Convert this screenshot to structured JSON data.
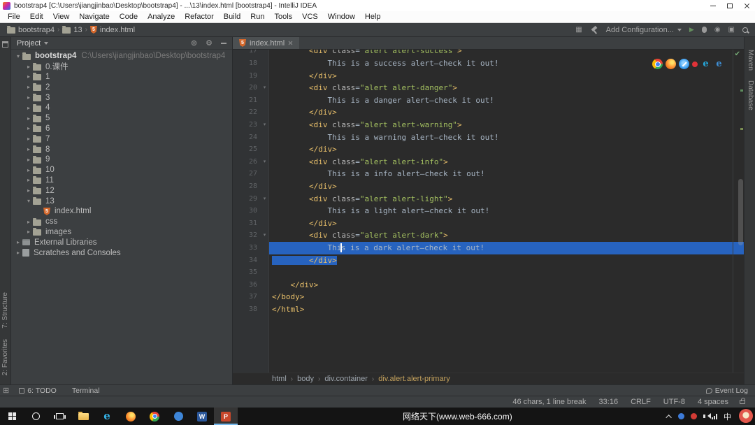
{
  "window": {
    "title": "bootstrap4 [C:\\Users\\jiangjinbao\\Desktop\\bootstrap4] - ...\\13\\index.html [bootstrap4] - IntelliJ IDEA"
  },
  "menu": {
    "items": [
      "File",
      "Edit",
      "View",
      "Navigate",
      "Code",
      "Analyze",
      "Refactor",
      "Build",
      "Run",
      "Tools",
      "VCS",
      "Window",
      "Help"
    ]
  },
  "navbar": {
    "crumbs": [
      {
        "label": "bootstrap4",
        "icon": "folder"
      },
      {
        "label": "13",
        "icon": "folder"
      },
      {
        "label": "index.html",
        "icon": "html"
      }
    ],
    "add_configuration": "Add Configuration..."
  },
  "project_panel": {
    "title": "Project",
    "tree": [
      {
        "label": "bootstrap4",
        "suffix": "C:\\Users\\jiangjinbao\\Desktop\\bootstrap4",
        "icon": "folder",
        "depth": 0,
        "chevron": "down",
        "bold": true
      },
      {
        "label": "0.课件",
        "icon": "folder",
        "depth": 1,
        "chevron": "right"
      },
      {
        "label": "1",
        "icon": "folder",
        "depth": 1,
        "chevron": "right"
      },
      {
        "label": "2",
        "icon": "folder",
        "depth": 1,
        "chevron": "right"
      },
      {
        "label": "3",
        "icon": "folder",
        "depth": 1,
        "chevron": "right"
      },
      {
        "label": "4",
        "icon": "folder",
        "depth": 1,
        "chevron": "right"
      },
      {
        "label": "5",
        "icon": "folder",
        "depth": 1,
        "chevron": "right"
      },
      {
        "label": "6",
        "icon": "folder",
        "depth": 1,
        "chevron": "right"
      },
      {
        "label": "7",
        "icon": "folder",
        "depth": 1,
        "chevron": "right"
      },
      {
        "label": "8",
        "icon": "folder",
        "depth": 1,
        "chevron": "right"
      },
      {
        "label": "9",
        "icon": "folder",
        "depth": 1,
        "chevron": "right"
      },
      {
        "label": "10",
        "icon": "folder",
        "depth": 1,
        "chevron": "right"
      },
      {
        "label": "11",
        "icon": "folder",
        "depth": 1,
        "chevron": "right"
      },
      {
        "label": "12",
        "icon": "folder",
        "depth": 1,
        "chevron": "right"
      },
      {
        "label": "13",
        "icon": "folder",
        "depth": 1,
        "chevron": "down"
      },
      {
        "label": "index.html",
        "icon": "html",
        "depth": 2,
        "chevron": "none"
      },
      {
        "label": "css",
        "icon": "folder",
        "depth": 1,
        "chevron": "right"
      },
      {
        "label": "images",
        "icon": "folder",
        "depth": 1,
        "chevron": "right"
      },
      {
        "label": "External Libraries",
        "icon": "lib",
        "depth": 0,
        "chevron": "right"
      },
      {
        "label": "Scratches and Consoles",
        "icon": "scratch",
        "depth": 0,
        "chevron": "right"
      }
    ]
  },
  "tabs": [
    {
      "label": "index.html",
      "icon": "html"
    }
  ],
  "editor": {
    "lines": [
      {
        "n": 17,
        "partial": true,
        "tokens": [
          {
            "c": "ws",
            "t": "        "
          },
          {
            "c": "tag",
            "t": "<div "
          },
          {
            "c": "attr",
            "t": "class"
          },
          {
            "c": "eq",
            "t": "="
          },
          {
            "c": "str",
            "t": "\"alert alert-success\""
          },
          {
            "c": "tag",
            "t": ">"
          }
        ]
      },
      {
        "n": 18,
        "tokens": [
          {
            "c": "ws",
            "t": "            "
          },
          {
            "c": "text",
            "t": "This is a success alert—check it out!"
          }
        ]
      },
      {
        "n": 19,
        "tokens": [
          {
            "c": "ws",
            "t": "        "
          },
          {
            "c": "tag",
            "t": "</div>"
          }
        ]
      },
      {
        "n": 20,
        "fold": true,
        "tokens": [
          {
            "c": "ws",
            "t": "        "
          },
          {
            "c": "tag",
            "t": "<div "
          },
          {
            "c": "attr",
            "t": "class"
          },
          {
            "c": "eq",
            "t": "="
          },
          {
            "c": "str",
            "t": "\"alert alert-danger\""
          },
          {
            "c": "tag",
            "t": ">"
          }
        ]
      },
      {
        "n": 21,
        "tokens": [
          {
            "c": "ws",
            "t": "            "
          },
          {
            "c": "text",
            "t": "This is a danger alert—check it out!"
          }
        ]
      },
      {
        "n": 22,
        "tokens": [
          {
            "c": "ws",
            "t": "        "
          },
          {
            "c": "tag",
            "t": "</div>"
          }
        ]
      },
      {
        "n": 23,
        "fold": true,
        "tokens": [
          {
            "c": "ws",
            "t": "        "
          },
          {
            "c": "tag",
            "t": "<div "
          },
          {
            "c": "attr",
            "t": "class"
          },
          {
            "c": "eq",
            "t": "="
          },
          {
            "c": "str",
            "t": "\"alert alert-warning\""
          },
          {
            "c": "tag",
            "t": ">"
          }
        ]
      },
      {
        "n": 24,
        "tokens": [
          {
            "c": "ws",
            "t": "            "
          },
          {
            "c": "text",
            "t": "This is a warning alert—check it out!"
          }
        ]
      },
      {
        "n": 25,
        "tokens": [
          {
            "c": "ws",
            "t": "        "
          },
          {
            "c": "tag",
            "t": "</div>"
          }
        ]
      },
      {
        "n": 26,
        "fold": true,
        "tokens": [
          {
            "c": "ws",
            "t": "        "
          },
          {
            "c": "tag",
            "t": "<div "
          },
          {
            "c": "attr",
            "t": "class"
          },
          {
            "c": "eq",
            "t": "="
          },
          {
            "c": "str",
            "t": "\"alert alert-info\""
          },
          {
            "c": "tag",
            "t": ">"
          }
        ]
      },
      {
        "n": 27,
        "tokens": [
          {
            "c": "ws",
            "t": "            "
          },
          {
            "c": "text",
            "t": "This is a info alert—check it out!"
          }
        ]
      },
      {
        "n": 28,
        "tokens": [
          {
            "c": "ws",
            "t": "        "
          },
          {
            "c": "tag",
            "t": "</div>"
          }
        ]
      },
      {
        "n": 29,
        "fold": true,
        "tokens": [
          {
            "c": "ws",
            "t": "        "
          },
          {
            "c": "tag",
            "t": "<div "
          },
          {
            "c": "attr",
            "t": "class"
          },
          {
            "c": "eq",
            "t": "="
          },
          {
            "c": "str",
            "t": "\"alert alert-light\""
          },
          {
            "c": "tag",
            "t": ">"
          }
        ]
      },
      {
        "n": 30,
        "tokens": [
          {
            "c": "ws",
            "t": "            "
          },
          {
            "c": "text",
            "t": "This is a light alert—check it out!"
          }
        ]
      },
      {
        "n": 31,
        "tokens": [
          {
            "c": "ws",
            "t": "        "
          },
          {
            "c": "tag",
            "t": "</div>"
          }
        ]
      },
      {
        "n": 32,
        "fold": true,
        "tokens": [
          {
            "c": "ws",
            "t": "        "
          },
          {
            "c": "tag",
            "t": "<div "
          },
          {
            "c": "attr",
            "t": "class"
          },
          {
            "c": "eq",
            "t": "="
          },
          {
            "c": "str",
            "t": "\"alert alert-dark\""
          },
          {
            "c": "tag",
            "t": ">"
          }
        ]
      },
      {
        "n": 33,
        "sel": "full",
        "tokens": [
          {
            "c": "ws",
            "t": "            "
          },
          {
            "c": "text",
            "t": "Thi"
          },
          {
            "c": "caret",
            "t": ""
          },
          {
            "c": "text",
            "t": "s is a dark alert—check it out!"
          }
        ]
      },
      {
        "n": 34,
        "sel": "text",
        "tokens": [
          {
            "c": "ws",
            "t": "        "
          },
          {
            "c": "tag",
            "t": "</div>"
          }
        ]
      },
      {
        "n": 35,
        "tokens": []
      },
      {
        "n": 36,
        "tokens": [
          {
            "c": "ws",
            "t": "    "
          },
          {
            "c": "tag",
            "t": "</div>"
          }
        ]
      },
      {
        "n": 37,
        "tokens": [
          {
            "c": "tag",
            "t": "</body>"
          }
        ]
      },
      {
        "n": 38,
        "tokens": [
          {
            "c": "tag",
            "t": "</html>"
          }
        ]
      }
    ],
    "breadcrumbs": [
      {
        "label": "html"
      },
      {
        "label": "body"
      },
      {
        "label": "div.container"
      },
      {
        "label": "div.alert.alert-primary",
        "current": true
      }
    ]
  },
  "browser_icons": [
    "chrome",
    "firefox",
    "safari",
    "opera",
    "edge",
    "ie"
  ],
  "tool_windows": {
    "left": [
      {
        "label": "7: Structure"
      },
      {
        "label": "2: Favorites"
      }
    ],
    "right": [
      {
        "label": "Maven"
      },
      {
        "label": "Database"
      }
    ],
    "bottom": [
      {
        "label": "6: TODO"
      },
      {
        "label": "Terminal"
      }
    ],
    "event_log": "Event Log"
  },
  "status_bar": {
    "selection_info": "46 chars, 1 line break",
    "caret_position": "33:16",
    "line_separator": "CRLF",
    "encoding": "UTF-8",
    "indent": "4 spaces"
  },
  "taskbar": {
    "apps": [
      "start",
      "search",
      "task-view",
      "file-explorer",
      "ie",
      "firefox",
      "chrome",
      "app",
      "word",
      "powerpoint"
    ],
    "site_text": "网络天下(www.web-666.com)",
    "ime": "中"
  }
}
